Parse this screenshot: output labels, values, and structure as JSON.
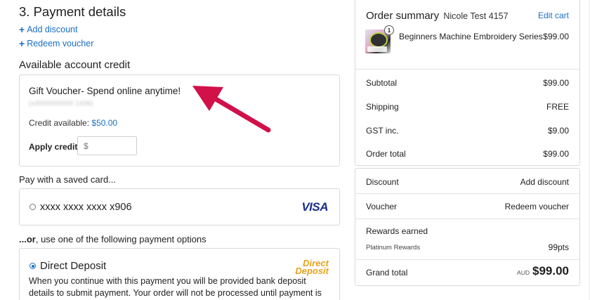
{
  "payment": {
    "title": "3. Payment details",
    "add_discount": "Add discount",
    "redeem_voucher": "Redeem voucher",
    "credit_heading": "Available account credit",
    "gift_voucher_title": "Gift Voucher- Spend online anytime!",
    "gift_voucher_number": "(x3000000000 1436)",
    "credit_label": "Credit available:",
    "credit_value": "$50.00",
    "apply_label": "Apply credit",
    "apply_input_placeholder": "$",
    "saved_card_heading": "Pay with a saved card...",
    "saved_card_number": "xxxx xxxx xxxx x906",
    "card_brand": "VISA",
    "or_heading_bold": "...or",
    "or_heading_rest": ", use one of the following payment options",
    "direct_deposit_label": "Direct Deposit",
    "direct_deposit_logo_line1": "Direct",
    "direct_deposit_logo_line2": "Deposit",
    "direct_deposit_desc": "When you continue with this payment you will be provided bank deposit details to submit payment. Your order will not be processed until payment is received."
  },
  "summary": {
    "title": "Order summary",
    "customer": "Nicole Test 4157",
    "edit_cart": "Edit cart",
    "product": {
      "qty": "1",
      "name": "Beginners Machine Embroidery Series",
      "price": "$99.00"
    },
    "rows": [
      {
        "label": "Subtotal",
        "value": "$99.00"
      },
      {
        "label": "Shipping",
        "value": "FREE"
      },
      {
        "label": "GST inc.",
        "value": "$9.00"
      },
      {
        "label": "Order total",
        "value": "$99.00"
      }
    ],
    "discount_label": "Discount",
    "discount_action": "Add discount",
    "voucher_label": "Voucher",
    "voucher_action": "Redeem voucher",
    "rewards_label": "Rewards earned",
    "rewards_tier": "Platinum Rewards",
    "rewards_points": "99pts",
    "grand_total_label": "Grand total",
    "grand_total_currency": "AUD",
    "grand_total_value": "$99.00"
  },
  "colors": {
    "link": "#1a6fc4",
    "arrow": "#d0114a",
    "direct_deposit_logo": "#e8a21b",
    "visa": "#1a2d8a"
  }
}
